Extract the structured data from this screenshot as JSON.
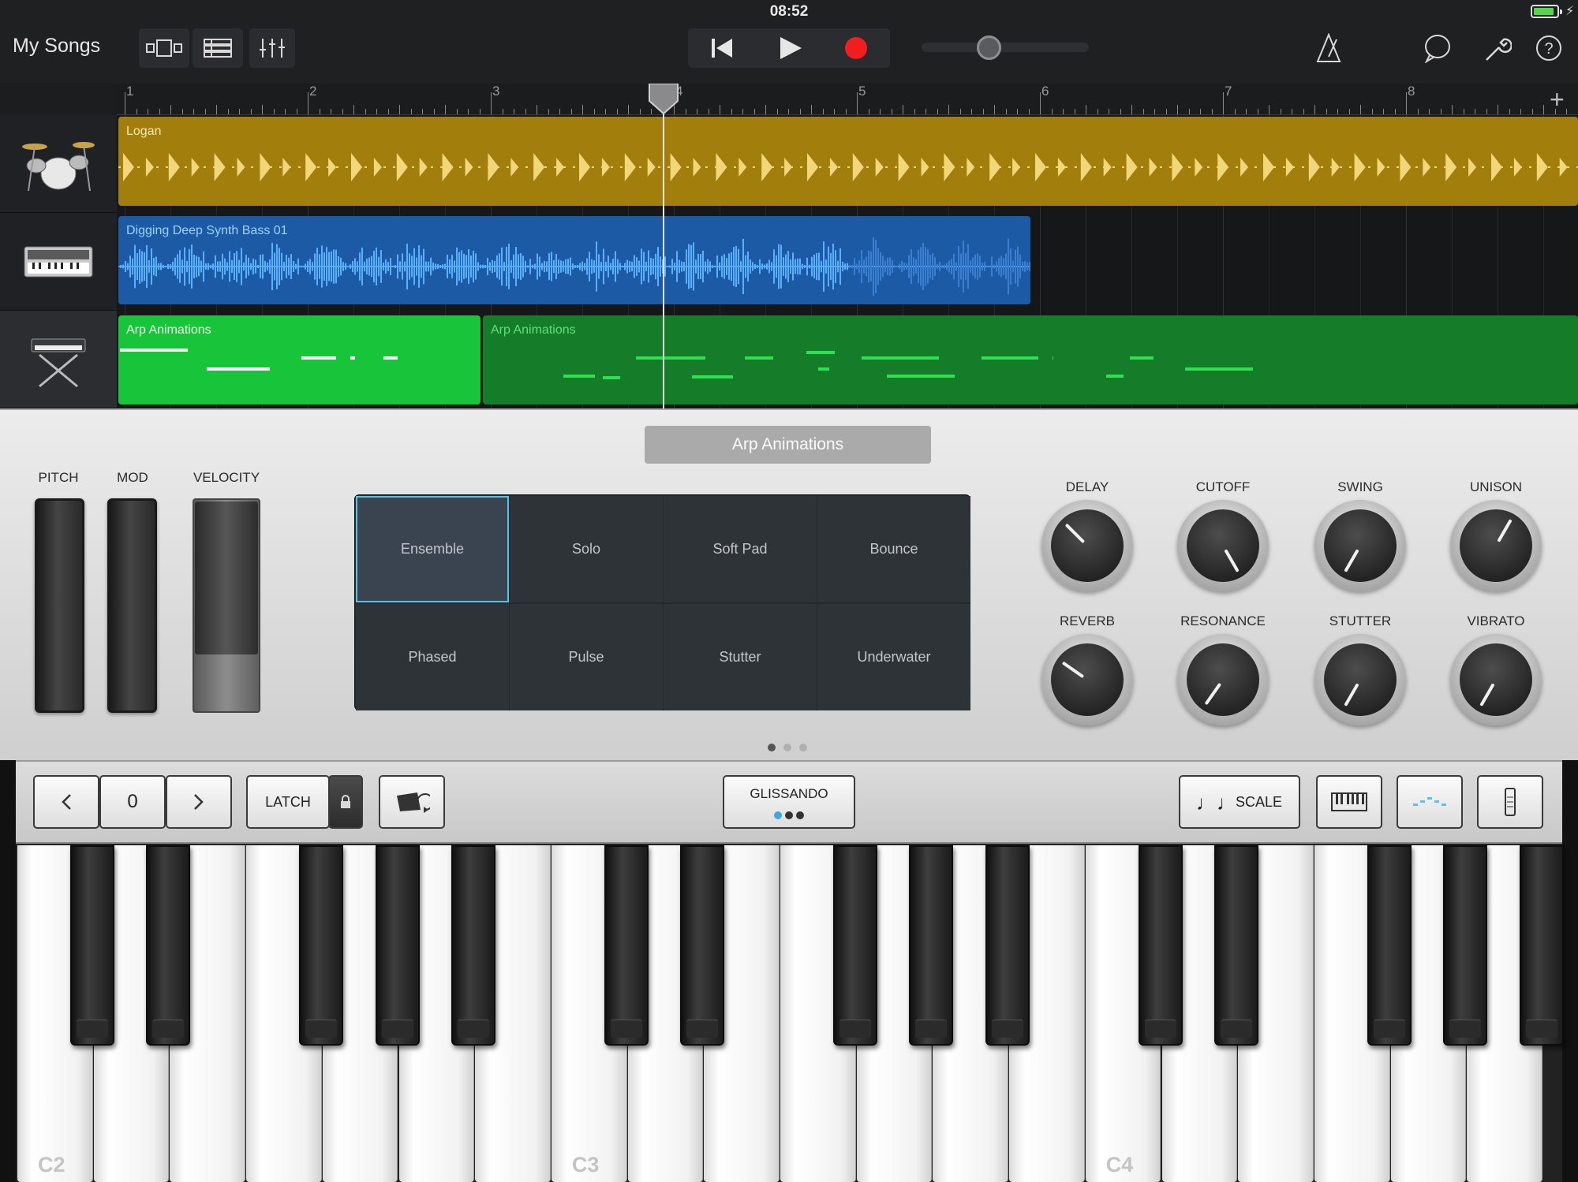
{
  "status": {
    "time": "08:52"
  },
  "toolbar": {
    "back_label": "My Songs",
    "icons": [
      "track-view-icon",
      "tracks-list-icon",
      "mixer-icon",
      "rewind-icon",
      "play-icon",
      "record-icon",
      "metronome-icon",
      "loop-browser-icon",
      "settings-wrench-icon",
      "help-icon"
    ],
    "master_volume": 0.4
  },
  "ruler": {
    "bars": [
      "1",
      "2",
      "3",
      "4",
      "5",
      "6",
      "7",
      "8"
    ],
    "playhead_bar": 4
  },
  "tracks": [
    {
      "instrument": "drums",
      "regions": [
        {
          "name": "Logan",
          "color": "#a27e0c"
        }
      ]
    },
    {
      "instrument": "synth-bass",
      "regions": [
        {
          "name": "Digging Deep Synth Bass 01",
          "color": "#1d5aa6"
        }
      ]
    },
    {
      "instrument": "keyboard",
      "regions": [
        {
          "name": "Arp Animations",
          "color": "#17c43a"
        },
        {
          "name": "Arp Animations",
          "color": "#157c2a"
        }
      ]
    }
  ],
  "instrument": {
    "patch_name": "Arp Animations",
    "wheels": {
      "pitch": "PITCH",
      "mod": "MOD",
      "velocity": "VELOCITY"
    },
    "pads": [
      "Ensemble",
      "Solo",
      "Soft Pad",
      "Bounce",
      "Phased",
      "Pulse",
      "Stutter",
      "Underwater"
    ],
    "selected_pad": "Ensemble",
    "knobs": [
      {
        "label": "DELAY",
        "angle": -45
      },
      {
        "label": "CUTOFF",
        "angle": 150
      },
      {
        "label": "SWING",
        "angle": -150
      },
      {
        "label": "UNISON",
        "angle": 30
      },
      {
        "label": "REVERB",
        "angle": -55
      },
      {
        "label": "RESONANCE",
        "angle": -145
      },
      {
        "label": "STUTTER",
        "angle": -150
      },
      {
        "label": "VIBRATO",
        "angle": -150
      }
    ],
    "page_dots": 3,
    "current_page": 1
  },
  "controls": {
    "octave_value": "0",
    "latch_label": "LATCH",
    "glissando_label": "GLISSANDO",
    "scale_label": "SCALE"
  },
  "keyboard": {
    "labels": [
      "C2",
      "C3",
      "C4"
    ]
  }
}
